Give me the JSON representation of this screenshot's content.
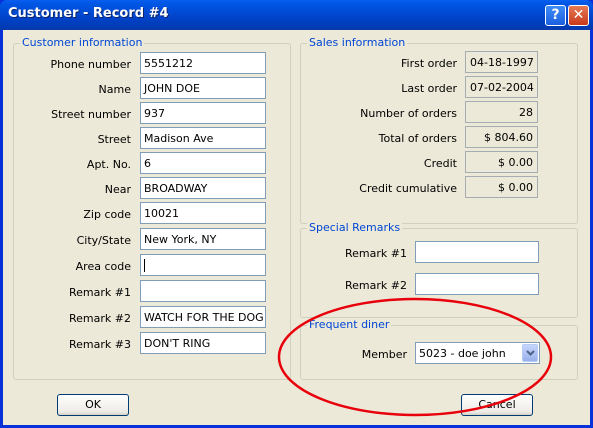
{
  "window": {
    "title": "Customer - Record #4",
    "help_glyph": "?",
    "close_glyph": "✕"
  },
  "customer_info": {
    "legend": "Customer information",
    "fields": [
      {
        "label": "Phone number",
        "value": "5551212"
      },
      {
        "label": "Name",
        "value": "JOHN DOE"
      },
      {
        "label": "Street number",
        "value": "937"
      },
      {
        "label": "Street",
        "value": "Madison Ave"
      },
      {
        "label": "Apt. No.",
        "value": "6"
      },
      {
        "label": "Near",
        "value": "BROADWAY"
      },
      {
        "label": "Zip code",
        "value": "10021"
      },
      {
        "label": "City/State",
        "value": "New York, NY"
      },
      {
        "label": "Area code",
        "value": ""
      },
      {
        "label": "Remark #1",
        "value": ""
      },
      {
        "label": "Remark #2",
        "value": "WATCH FOR THE DOG"
      },
      {
        "label": "Remark #3",
        "value": "DON'T RING"
      }
    ]
  },
  "sales_info": {
    "legend": "Sales information",
    "fields": [
      {
        "label": "First order",
        "value": "04-18-1997"
      },
      {
        "label": "Last order",
        "value": "07-02-2004"
      },
      {
        "label": "Number of orders",
        "value": "28"
      },
      {
        "label": "Total of orders",
        "value": "$ 804.60"
      },
      {
        "label": "Credit",
        "value": "$ 0.00"
      },
      {
        "label": "Credit cumulative",
        "value": "$ 0.00"
      }
    ]
  },
  "special_remarks": {
    "legend": "Special Remarks",
    "fields": [
      {
        "label": "Remark #1",
        "value": ""
      },
      {
        "label": "Remark #2",
        "value": ""
      }
    ]
  },
  "frequent_diner": {
    "legend": "Frequent diner",
    "member_label": "Member",
    "member_value": "5023 - doe john"
  },
  "buttons": {
    "ok": "OK",
    "cancel": "Cancel"
  },
  "colors": {
    "titlebar": "#0054e3",
    "legend": "#0046d5",
    "highlight_ellipse": "#e8000b"
  }
}
